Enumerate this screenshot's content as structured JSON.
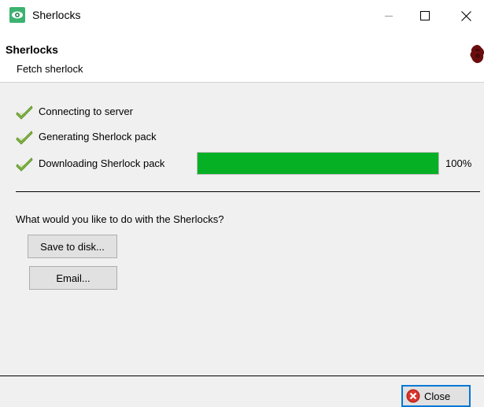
{
  "window": {
    "title": "Sherlocks",
    "icon": "eye-app-icon",
    "controls": [
      "minimize-icon",
      "maximize-icon",
      "close-icon"
    ]
  },
  "header": {
    "title": "Sherlocks",
    "subtitle": "Fetch sherlock",
    "logo": "sherlock-logo-icon"
  },
  "steps": [
    {
      "label": "Connecting to server",
      "status": "done",
      "icon": "checkmark-icon"
    },
    {
      "label": "Generating Sherlock pack",
      "status": "done",
      "icon": "checkmark-icon"
    },
    {
      "label": "Downloading Sherlock pack",
      "status": "done",
      "icon": "checkmark-icon"
    }
  ],
  "progress": {
    "value": 1.0,
    "label": "100%",
    "color": "#06b025"
  },
  "question": "What would you like to do with the Sherlocks?",
  "actions": {
    "save_label": "Save to disk...",
    "email_label": "Email..."
  },
  "footer": {
    "close_label": "Close",
    "close_icon": "red-x-circle-icon"
  }
}
